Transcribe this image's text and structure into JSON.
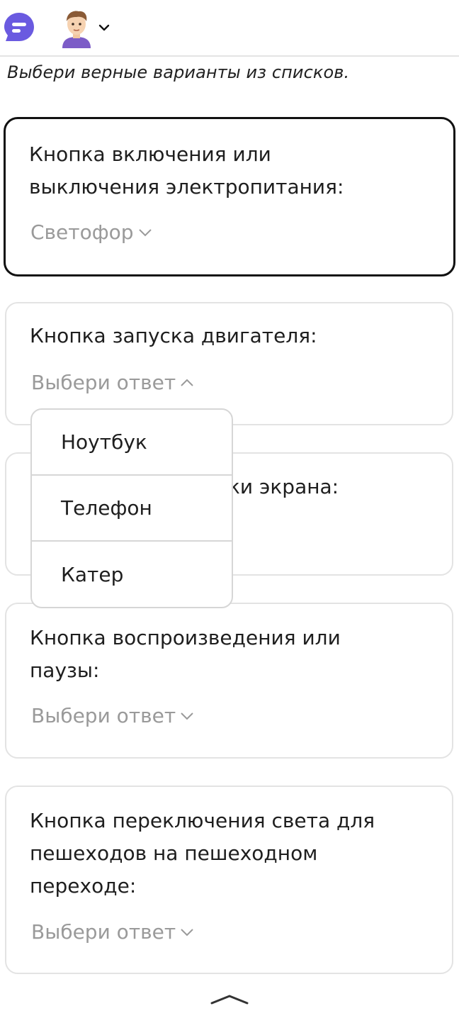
{
  "header": {
    "logo_icon": "chat-bubble-logo-icon",
    "avatar_icon": "boy-avatar-icon",
    "menu_icon": "chevron-down-icon"
  },
  "instruction": "Выбери верные варианты из списков.",
  "questions": [
    {
      "line1": "Кнопка включения или",
      "line2": "выключения электропитания:",
      "answer": "Светофор"
    },
    {
      "line1": "Кнопка запуска двигателя:",
      "answer": "Выбери ответ"
    },
    {
      "line1": "ки экрана:",
      "answer": ""
    },
    {
      "line1": "Кнопка воспроизведения или",
      "line2": "паузы:",
      "answer": "Выбери ответ"
    },
    {
      "line1": "Кнопка переключения света для",
      "line2": "пешеходов на пешеходном",
      "line3": "переходе:",
      "answer": "Выбери ответ"
    }
  ],
  "dropdown": {
    "options": [
      "Ноутбук",
      "Телефон",
      "Катер"
    ]
  },
  "footer": {
    "collapse_icon": "chevron-up-icon"
  },
  "colors": {
    "accent": "#6a5ae0",
    "active_border": "#111111",
    "placeholder": "#9a9a9a",
    "card_border": "#e3e3e3"
  }
}
